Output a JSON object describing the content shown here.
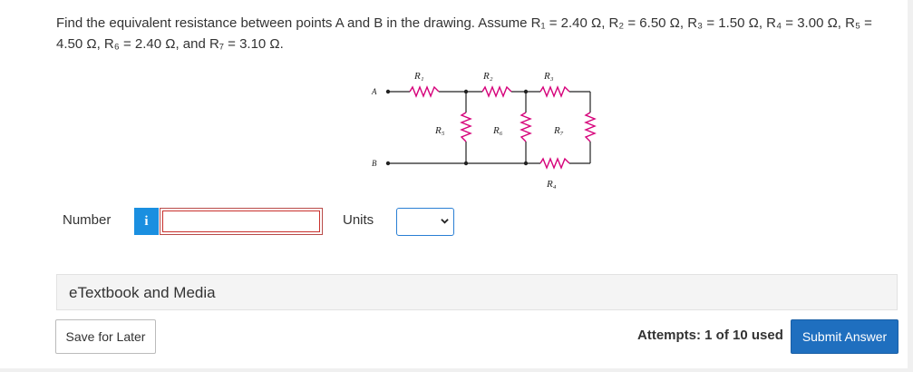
{
  "question": {
    "line1": "Find the equivalent resistance between points A and B in the drawing. Assume R₁ = 2.40 Ω, R₂ = 6.50 Ω, R₃ = 1.50 Ω, R₄ = 3.00 Ω, R₅ =",
    "line2": "4.50 Ω, R₆ = 2.40 Ω, and R₇ = 3.10 Ω."
  },
  "circuit": {
    "point_a": "A",
    "point_b": "B",
    "r1": "R₁",
    "r2": "R₂",
    "r3": "R₃",
    "r4": "R₄",
    "r5": "R₅",
    "r6": "R₆",
    "r7": "R₇",
    "wire_color": "#222222",
    "resistor_color": "#d6007a"
  },
  "answer": {
    "number_label": "Number",
    "info_icon": "i",
    "number_value": "",
    "units_label": "Units",
    "units_value": ""
  },
  "etextbook": {
    "label": "eTextbook and Media"
  },
  "footer": {
    "save_label": "Save for Later",
    "attempts_text": "Attempts: 1 of 10 used",
    "submit_label": "Submit Answer"
  }
}
